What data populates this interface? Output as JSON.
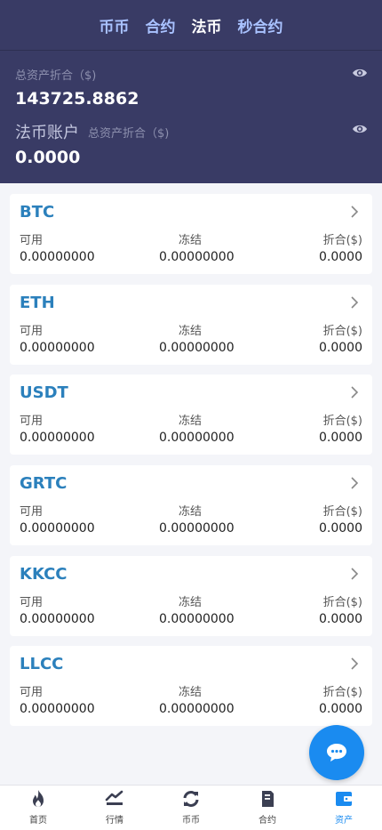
{
  "tabs": [
    {
      "label": "币币"
    },
    {
      "label": "合约"
    },
    {
      "label": "法币"
    },
    {
      "label": "秒合约"
    }
  ],
  "summary": {
    "total_label": "总资产折合（$)",
    "total_value": "143725.8862",
    "fiat_title": "法币账户",
    "fiat_sub_label": "总资产折合（$)",
    "fiat_value": "0.0000"
  },
  "columns": {
    "available": "可用",
    "frozen": "冻结",
    "converted": "折合($)"
  },
  "assets": [
    {
      "name": "BTC",
      "available": "0.00000000",
      "frozen": "0.00000000",
      "converted": "0.0000"
    },
    {
      "name": "ETH",
      "available": "0.00000000",
      "frozen": "0.00000000",
      "converted": "0.0000"
    },
    {
      "name": "USDT",
      "available": "0.00000000",
      "frozen": "0.00000000",
      "converted": "0.0000"
    },
    {
      "name": "GRTC",
      "available": "0.00000000",
      "frozen": "0.00000000",
      "converted": "0.0000"
    },
    {
      "name": "KKCC",
      "available": "0.00000000",
      "frozen": "0.00000000",
      "converted": "0.0000"
    },
    {
      "name": "LLCC",
      "available": "0.00000000",
      "frozen": "0.00000000",
      "converted": "0.0000"
    }
  ],
  "bottom_nav": [
    {
      "label": "首页",
      "icon": "flame-icon"
    },
    {
      "label": "行情",
      "icon": "chart-trend-icon"
    },
    {
      "label": "币币",
      "icon": "refresh-icon"
    },
    {
      "label": "合约",
      "icon": "document-icon"
    },
    {
      "label": "资产",
      "icon": "wallet-icon"
    }
  ],
  "colors": {
    "header_bg": "#393b65",
    "tab_inactive": "#a9c2ff",
    "coin_name": "#2b80bc",
    "accent": "#1a8bf0"
  }
}
